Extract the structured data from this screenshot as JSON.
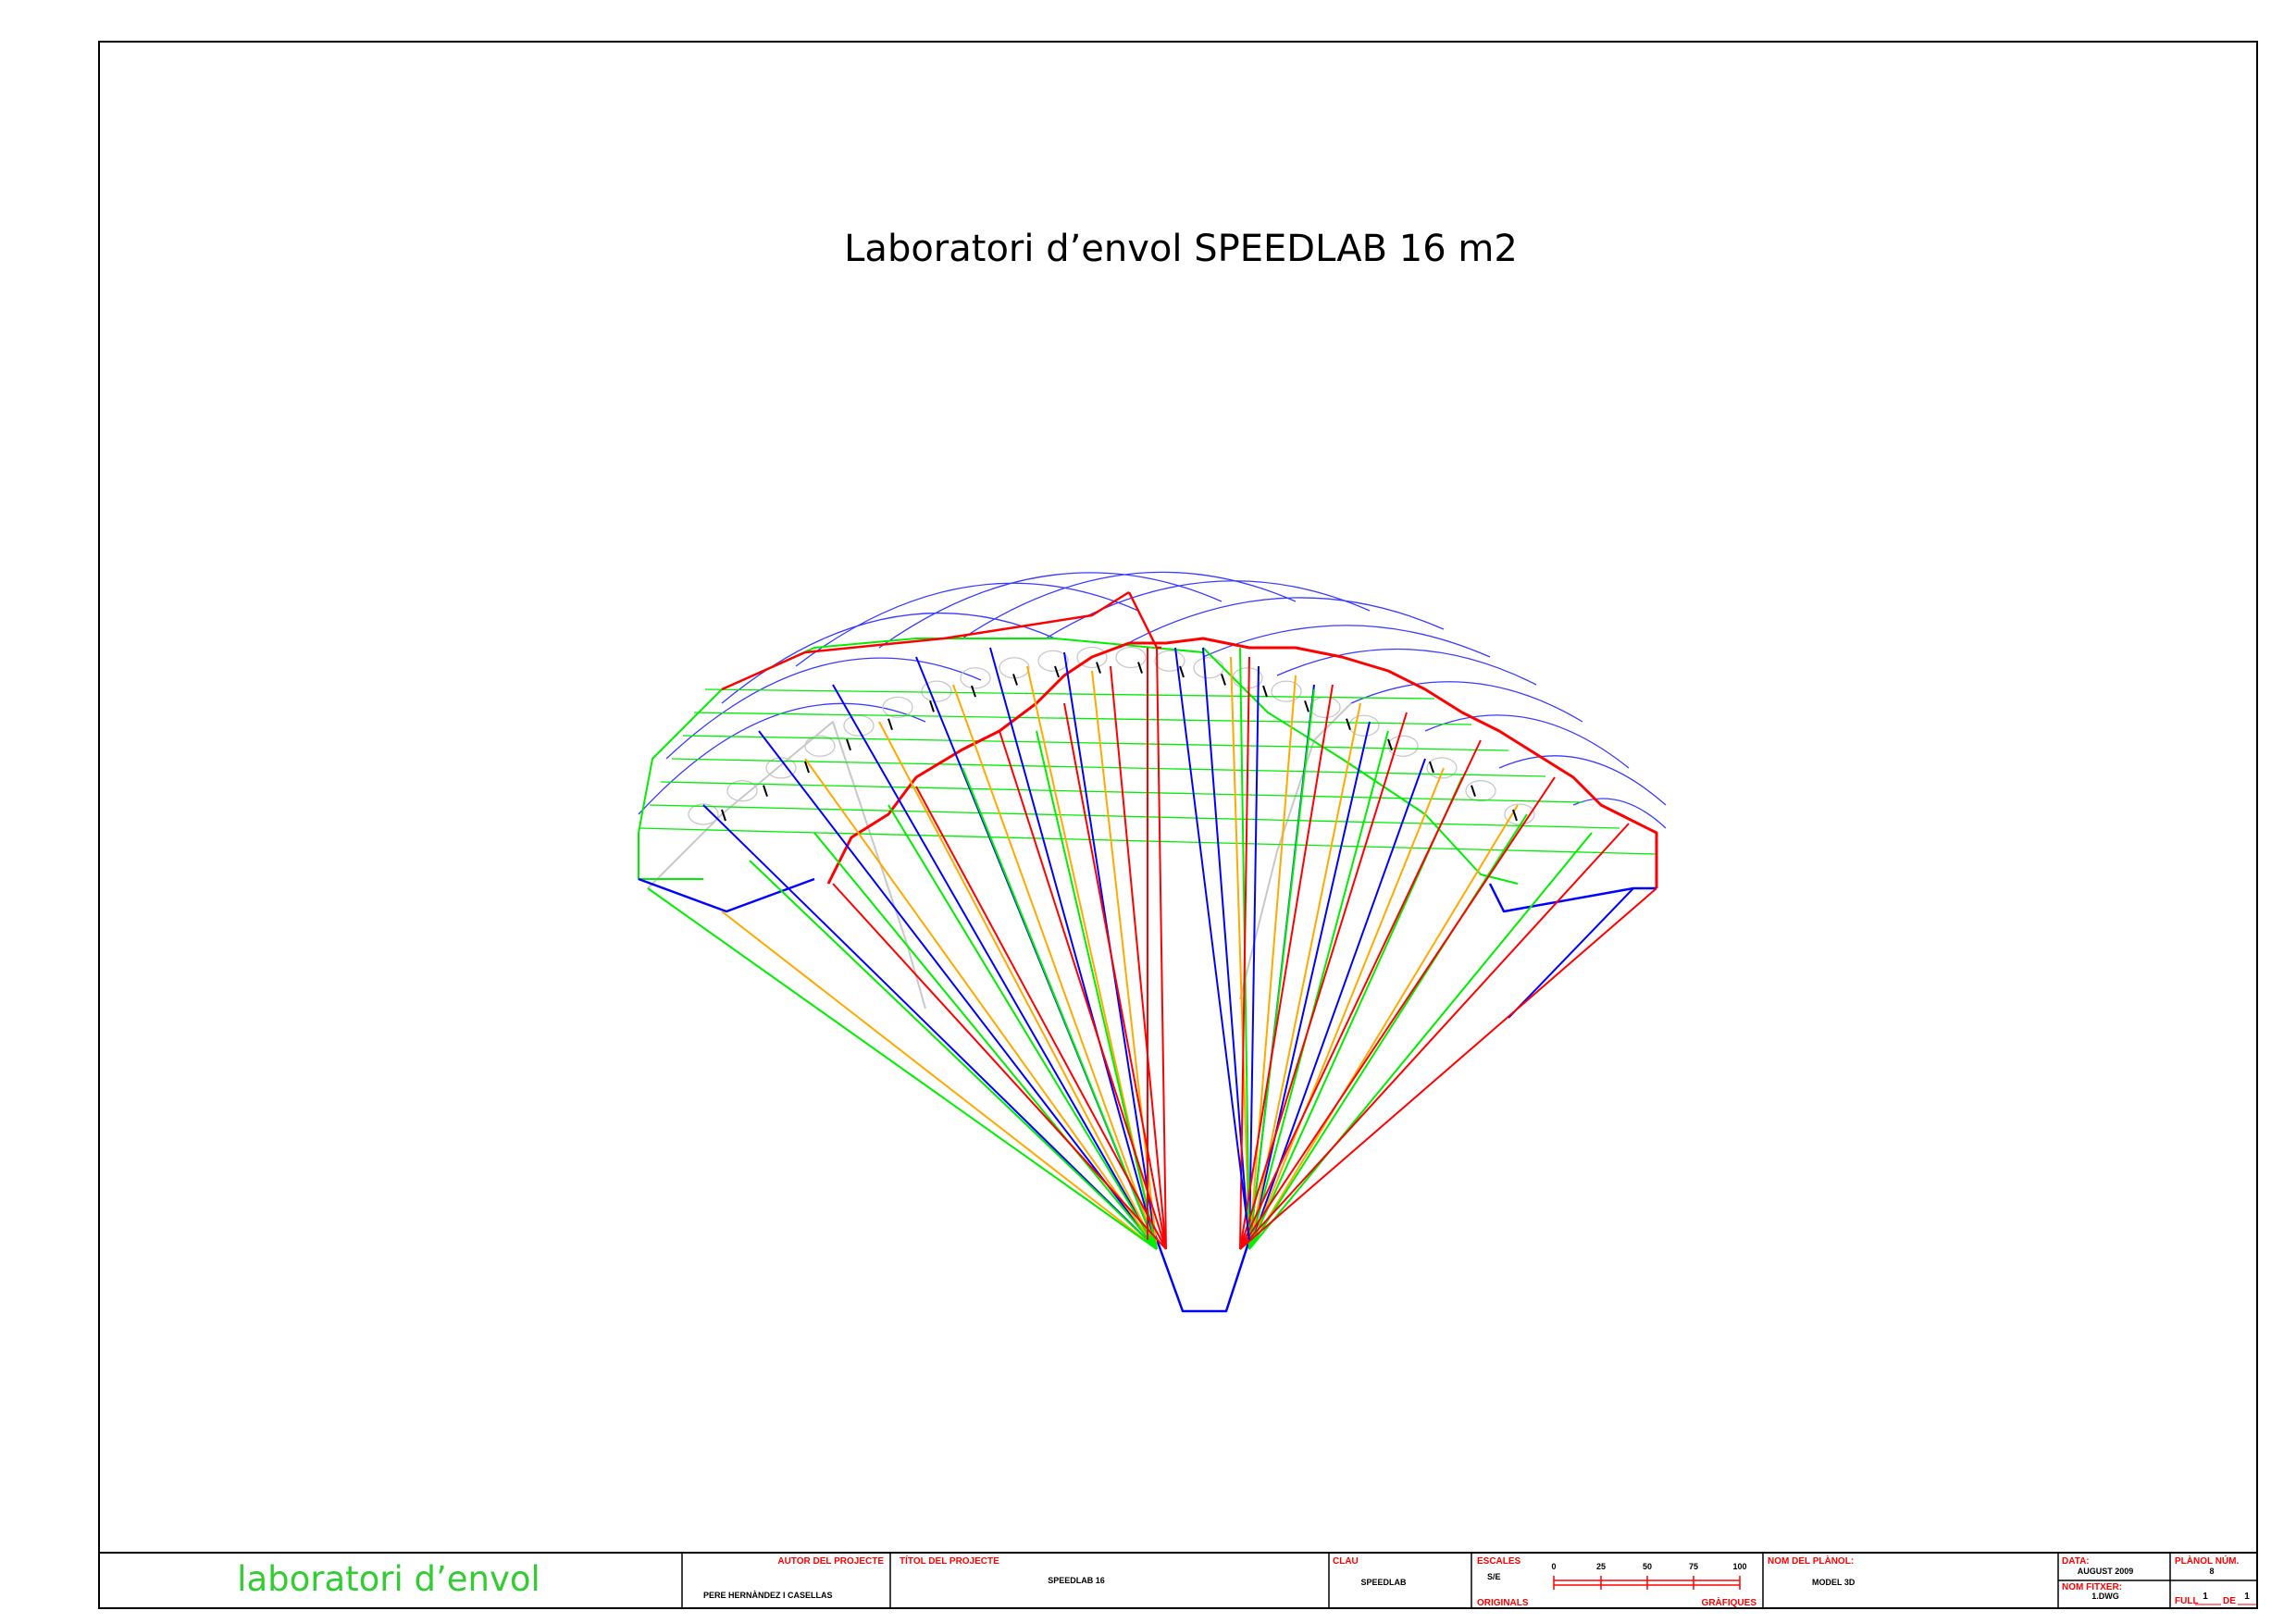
{
  "drawing": {
    "title": "Laboratori d’envol SPEEDLAB 16 m2"
  },
  "title_block": {
    "logo_text": "laboratori d’envol",
    "author_label": "AUTOR DEL PROJECTE",
    "author_value": "PERE HERNÀNDEZ I CASELLAS",
    "project_title_label": "TÍTOL DEL PROJECTE",
    "project_title_value": "SPEEDLAB 16",
    "key_label": "CLAU",
    "key_value": "SPEEDLAB",
    "scales_label": "ESCALES",
    "scales_value": "S/E",
    "originals_label": "ORIGINALS",
    "graphic_label": "GRÀFIQUES",
    "scale_ticks": [
      "0",
      "25",
      "50",
      "75",
      "100"
    ],
    "plan_name_label": "NOM DEL PLÀNOL:",
    "plan_name_value": "MODEL 3D",
    "date_label": "DATA:",
    "date_value": "AUGUST 2009",
    "file_label": "NOM FITXER:",
    "file_value": "1.DWG",
    "plan_number_label": "PLÀNOL NÚM.",
    "plan_number_value": "8",
    "sheet_prefix": "FULL",
    "sheet_value": "1",
    "sheet_of": "DE",
    "sheet_total": "1"
  },
  "colors": {
    "frame": "#000000",
    "red": "#ff0000",
    "green": "#00ee00",
    "blue": "#0000ff",
    "blue_light": "#3b3bff",
    "orange": "#ffaa00",
    "gray": "#c8c8c8",
    "logo_green": "#33cc33"
  }
}
